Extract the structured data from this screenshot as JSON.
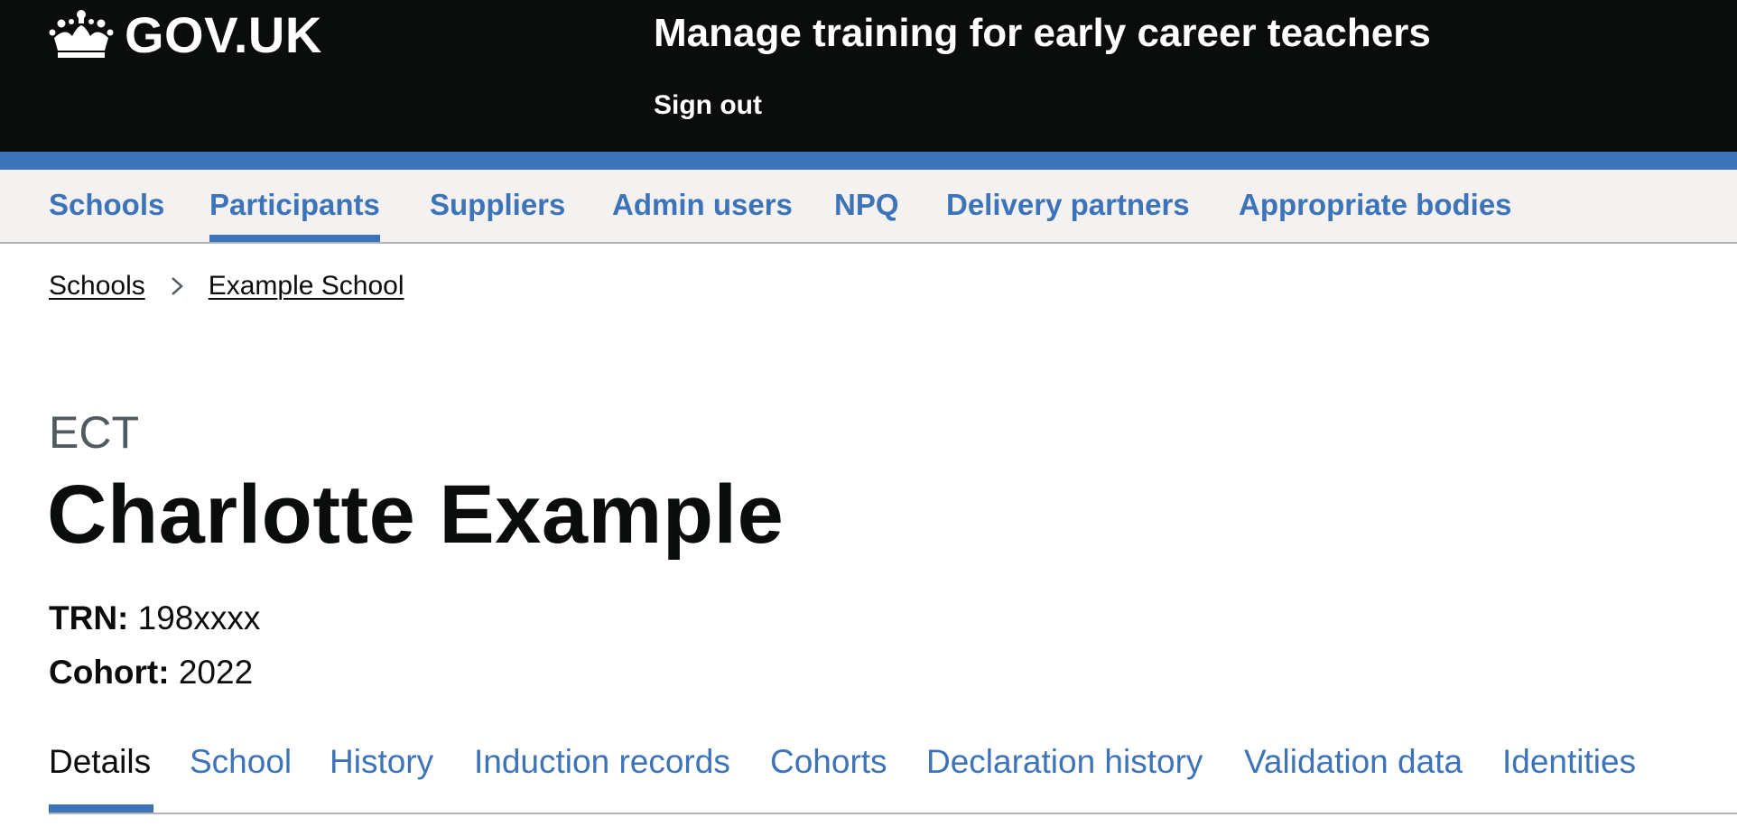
{
  "header": {
    "logo_text": "GOV.UK",
    "service_name": "Manage training for early career teachers",
    "sign_out_label": "Sign out",
    "brand_color": "#0b0c0c",
    "accent_color": "#3d73b9"
  },
  "primary_nav": {
    "items": [
      {
        "label": "Schools",
        "active": false
      },
      {
        "label": "Participants",
        "active": true
      },
      {
        "label": "Suppliers",
        "active": false
      },
      {
        "label": "Admin users",
        "active": false
      },
      {
        "label": "NPQ",
        "active": false
      },
      {
        "label": "Delivery partners",
        "active": false
      },
      {
        "label": "Appropriate bodies",
        "active": false
      }
    ]
  },
  "breadcrumbs": [
    {
      "label": "Schools"
    },
    {
      "label": "Example School"
    }
  ],
  "participant": {
    "type_caption": "ECT",
    "name": "Charlotte Example",
    "trn_label": "TRN:",
    "trn_value": "198xxxx",
    "cohort_label": "Cohort:",
    "cohort_value": "2022"
  },
  "tabs": {
    "selected": "Details",
    "items": [
      {
        "label": "Details"
      },
      {
        "label": "School"
      },
      {
        "label": "History"
      },
      {
        "label": "Induction records"
      },
      {
        "label": "Cohorts"
      },
      {
        "label": "Declaration history"
      },
      {
        "label": "Validation data"
      },
      {
        "label": "Identities"
      }
    ]
  },
  "icons": {
    "logo": "crown-icon",
    "breadcrumb_separator": "chevron-right-icon"
  }
}
